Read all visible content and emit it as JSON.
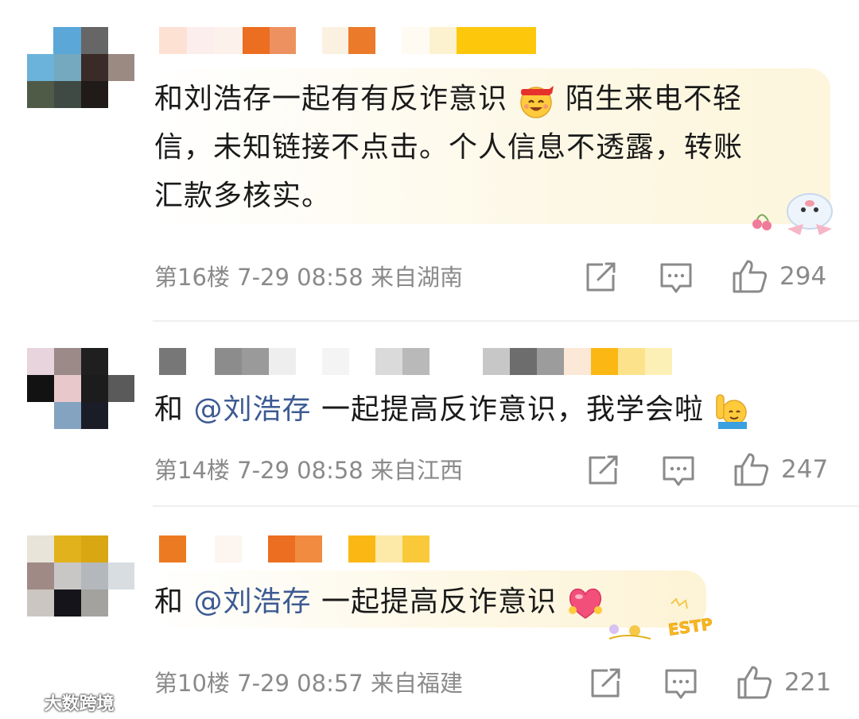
{
  "comments": [
    {
      "text_lines": [
        "和刘浩存一起有有反诈意识",
        "陌生来电不轻",
        "信，未知链接不点击。个人信息不透露，转账",
        "汇款多核实。"
      ],
      "floor": "第16楼",
      "date": "7-29",
      "time": "08:58",
      "location": "来自湖南",
      "likes": "294",
      "emoji_icon": "grinning-headband-face-icon"
    },
    {
      "prefix": "和",
      "mention": "@刘浩存",
      "suffix": "一起提高反诈意识，我学会啦",
      "floor": "第14楼",
      "date": "7-29",
      "time": "08:58",
      "location": "来自江西",
      "likes": "247",
      "emoji_icon": "raising-hand-icon"
    },
    {
      "prefix": "和",
      "mention": "@刘浩存",
      "suffix": "一起提高反诈意识",
      "floor": "第10楼",
      "date": "7-29",
      "time": "08:57",
      "location": "来自福建",
      "likes": "221",
      "emoji_icon": "heart-hug-icon",
      "bubble_badge": "ESTP"
    }
  ],
  "watermark": "大数跨境",
  "colors": {
    "mention": "#3d5b93",
    "meta": "#8a8a8a",
    "bubble_fill": "#fdf8e6"
  }
}
